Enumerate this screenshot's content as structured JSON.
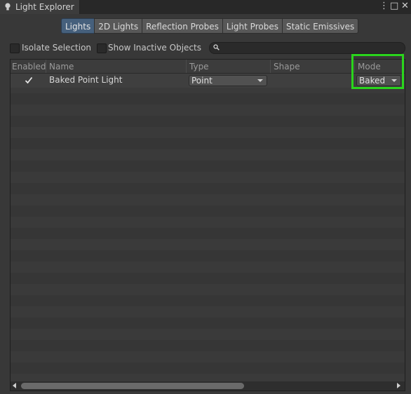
{
  "window": {
    "title": "Light Explorer",
    "controls": [
      "⋮",
      "□",
      "✕"
    ]
  },
  "tabs": [
    {
      "label": "Lights",
      "active": true
    },
    {
      "label": "2D Lights",
      "active": false
    },
    {
      "label": "Reflection Probes",
      "active": false
    },
    {
      "label": "Light Probes",
      "active": false
    },
    {
      "label": "Static Emissives",
      "active": false
    }
  ],
  "options": {
    "isolate_selection": {
      "label": "Isolate Selection",
      "checked": false
    },
    "show_inactive": {
      "label": "Show Inactive Objects",
      "checked": false
    },
    "search": {
      "placeholder": "",
      "icon": "search-icon"
    }
  },
  "table": {
    "columns": [
      "Enabled",
      "Name",
      "Type",
      "Shape",
      "Mode"
    ],
    "rows": [
      {
        "enabled": true,
        "name": "Baked Point Light",
        "type": "Point",
        "shape": "",
        "mode": "Baked"
      }
    ]
  },
  "highlight_color": "#2ad51c"
}
